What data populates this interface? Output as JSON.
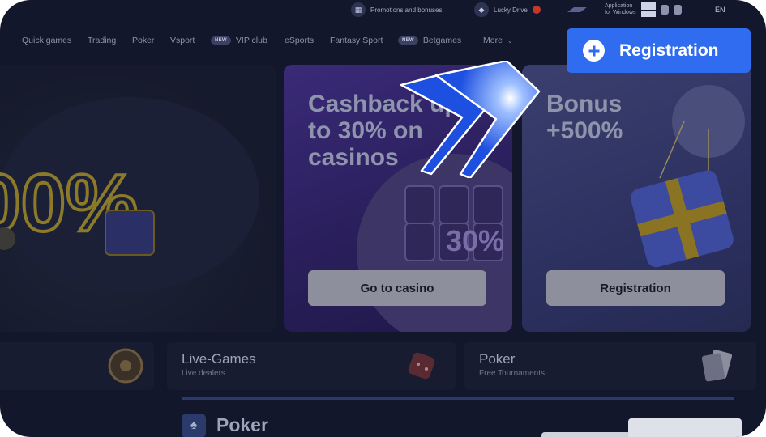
{
  "topbar": {
    "promotions": "Promotions and bonuses",
    "lucky_drive": "Lucky Drive",
    "app_line1": "Application",
    "app_line2": "for Windows",
    "language": "EN"
  },
  "nav": {
    "items": [
      {
        "label": "Quick games"
      },
      {
        "label": "Trading"
      },
      {
        "label": "Poker"
      },
      {
        "label": "Vsport"
      },
      {
        "label": "VIP club",
        "badge": "NEW"
      },
      {
        "label": "eSports"
      },
      {
        "label": "Fantasy Sport"
      },
      {
        "label": "Betgames",
        "badge": "NEW"
      },
      {
        "label": "More"
      }
    ]
  },
  "registration_button": "Registration",
  "promos": {
    "left_text": "00%",
    "casino": {
      "title_line1": "Cashback up",
      "title_line2": "to 30% on",
      "title_line3": "casinos",
      "button": "Go to casino",
      "reel_text": "30%"
    },
    "bonus": {
      "title_line1": "Bonus",
      "title_line2": "+500%",
      "button": "Registration"
    }
  },
  "tiles": {
    "live": {
      "title": "Live-Games",
      "subtitle": "Live dealers"
    },
    "poker": {
      "title": "Poker",
      "subtitle": "Free Tournaments"
    }
  },
  "section": {
    "title": "Poker"
  },
  "colors": {
    "accent": "#2f6cf0",
    "background": "#13172b",
    "logo_blue": "#1d4fe0"
  }
}
